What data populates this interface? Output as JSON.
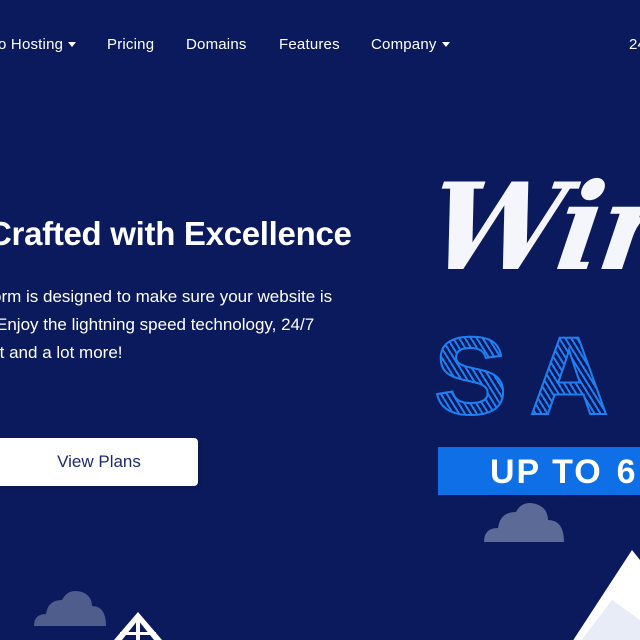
{
  "nav": {
    "items": [
      {
        "label": "o Hosting",
        "has_dropdown": true
      },
      {
        "label": "Pricing",
        "has_dropdown": false
      },
      {
        "label": "Domains",
        "has_dropdown": false
      },
      {
        "label": "Features",
        "has_dropdown": false
      },
      {
        "label": "Company",
        "has_dropdown": true
      },
      {
        "label": "24",
        "has_dropdown": false
      }
    ]
  },
  "hero": {
    "title": "Crafted with Excellence",
    "description_lines": [
      "orm is designed to make sure your website is",
      "Enjoy the lightning speed technology, 24/7",
      "rt and a lot more!"
    ],
    "cta_label": "View Plans"
  },
  "promo": {
    "script_text": "Wir",
    "sale_text": "SA",
    "band_text": "UP TO",
    "band_percent": "6"
  },
  "colors": {
    "background": "#0b1a5c",
    "accent_blue": "#0e6fe6",
    "cta_bg": "#ffffff",
    "cta_text": "#1b2b6e"
  },
  "icons": [
    "caret-down-icon",
    "cloud-icon",
    "arrow-up-icon",
    "mountain-icon"
  ]
}
